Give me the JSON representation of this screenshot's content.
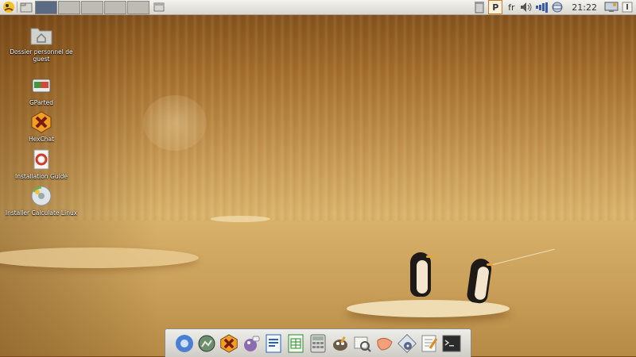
{
  "desktop": {
    "icons": [
      {
        "label": "Dossier personnel de guest",
        "icon": "home-folder-icon"
      },
      {
        "label": "GParted",
        "icon": "gparted-icon"
      },
      {
        "label": "HexChat",
        "icon": "hexchat-icon"
      },
      {
        "label": "Installation Guide",
        "icon": "installation-guide-icon"
      },
      {
        "label": "Installer Calculate Linux",
        "icon": "installer-disc-icon"
      }
    ]
  },
  "top_panel": {
    "workspaces": 5,
    "active_workspace": 1,
    "keyboard_layout": "fr",
    "clock": "21:22"
  },
  "dock": {
    "items": [
      "chromium-icon",
      "screenshot-icon",
      "hexchat-icon",
      "pidgin-icon",
      "writer-icon",
      "calc-icon",
      "calculator-icon",
      "gimp-icon",
      "image-viewer-icon",
      "mail-icon",
      "media-player-icon",
      "text-editor-icon",
      "terminal-icon"
    ]
  },
  "colors": {
    "panel": "#e6e4de",
    "wallpaper": "#c79a55",
    "active_workspace": "#5b6b84"
  }
}
